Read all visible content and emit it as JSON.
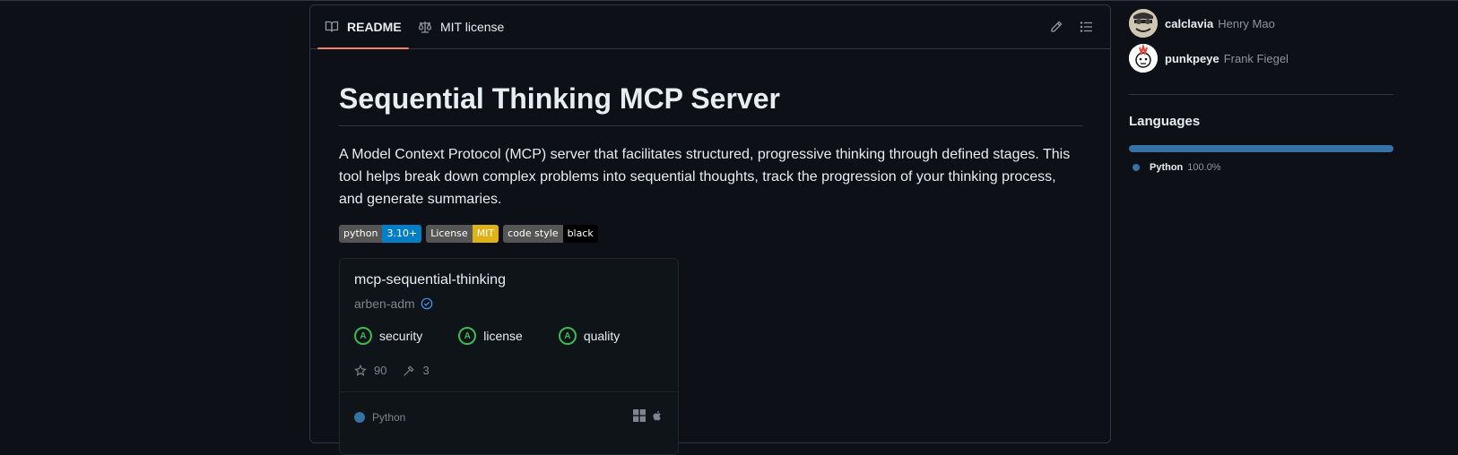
{
  "readme": {
    "tabs": [
      {
        "label": "README",
        "icon": "book-icon",
        "active": true
      },
      {
        "label": "MIT license",
        "icon": "scale-icon",
        "active": false
      }
    ],
    "title": "Sequential Thinking MCP Server",
    "description": "A Model Context Protocol (MCP) server that facilitates structured, progressive thinking through defined stages. This tool helps break down complex problems into sequential thoughts, track the progression of your thinking process, and generate summaries.",
    "badges": [
      {
        "label": "python",
        "value": "3.10+",
        "color": "#007ec6"
      },
      {
        "label": "License",
        "value": "MIT",
        "color": "#dfb317"
      },
      {
        "label": "code style",
        "value": "black",
        "color": "#000000"
      }
    ],
    "mcp_card": {
      "name": "mcp-sequential-thinking",
      "owner": "arben-adm",
      "grades": [
        {
          "grade": "A",
          "label": "security"
        },
        {
          "grade": "A",
          "label": "license"
        },
        {
          "grade": "A",
          "label": "quality"
        }
      ],
      "stars": "90",
      "tools": "3",
      "language": "Python",
      "language_color": "#3572A5"
    }
  },
  "sidebar": {
    "contributors": [
      {
        "login": "calclavia",
        "name": "Henry Mao"
      },
      {
        "login": "punkpeye",
        "name": "Frank Fiegel"
      }
    ],
    "languages_heading": "Languages",
    "languages": [
      {
        "name": "Python",
        "percent": "100.0%",
        "color": "#3572A5"
      }
    ]
  },
  "colors": {
    "background": "#0d1117",
    "border": "#30363d",
    "active_tab_underline": "#f78166",
    "grade_green": "#3fb950"
  }
}
